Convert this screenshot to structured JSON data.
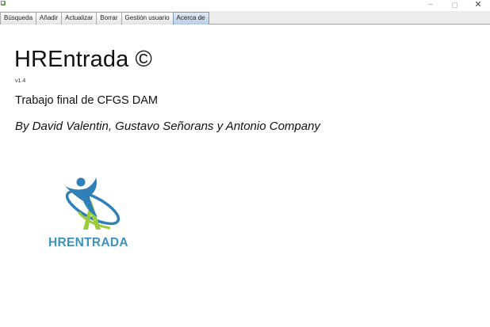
{
  "window": {
    "minimize_glyph": "–",
    "close_glyph": "✕"
  },
  "tabs": [
    {
      "label": "Búsqueda",
      "active": false
    },
    {
      "label": "Añadir",
      "active": false
    },
    {
      "label": "Actualizar",
      "active": false
    },
    {
      "label": "Borrar",
      "active": false
    },
    {
      "label": "Gestión usuario",
      "active": false
    },
    {
      "label": "Acerca de",
      "active": true
    }
  ],
  "about": {
    "title": "HREntrada ©",
    "version": "v1.4",
    "subtitle": "Trabajo final de CFGS DAM",
    "authors": "By David Valentin, Gustavo Señorans y Antonio Company"
  },
  "logo": {
    "text": "HRENTRADA",
    "colors": {
      "blue": "#2f7fb8",
      "green": "#9ccb3b",
      "text": "#3b94c0"
    }
  }
}
